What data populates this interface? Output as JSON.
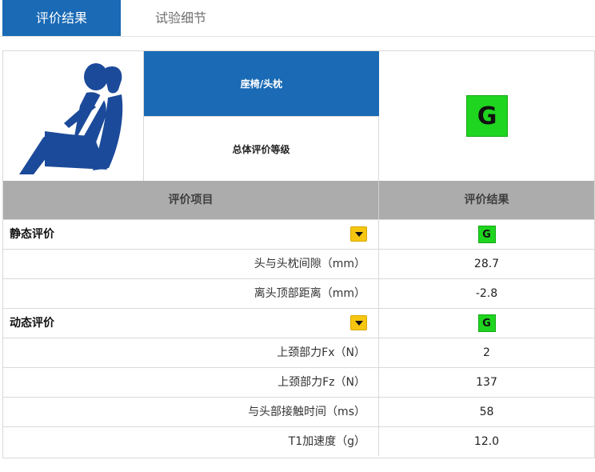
{
  "tabs": {
    "results_label": "评价结果",
    "details_label": "试验细节"
  },
  "summary": {
    "category": "座椅/头枕",
    "overall_label": "总体评价等级",
    "overall_rating": "G"
  },
  "table": {
    "header_item": "评价项目",
    "header_result": "评价结果"
  },
  "sections": {
    "static": {
      "label": "静态评价",
      "rating": "G",
      "rows": [
        {
          "item": "头与头枕间隙（mm）",
          "value": "28.7"
        },
        {
          "item": "离头顶部距离（mm）",
          "value": "-2.8"
        }
      ]
    },
    "dynamic": {
      "label": "动态评价",
      "rating": "G",
      "rows": [
        {
          "item": "上颈部力Fx（N）",
          "value": "2"
        },
        {
          "item": "上颈部力Fz（N）",
          "value": "137"
        },
        {
          "item": "与头部接触时间（ms）",
          "value": "58"
        },
        {
          "item": "T1加速度（g）",
          "value": "12.0"
        }
      ]
    }
  },
  "colors": {
    "brand_blue": "#1a6ab5",
    "rating_good": "#1fd51f",
    "toggle_yellow": "#f6c611",
    "header_gray": "#acacac"
  },
  "icons": {
    "seat": "seat-headrest-icon",
    "toggle": "chevron-down-icon"
  }
}
